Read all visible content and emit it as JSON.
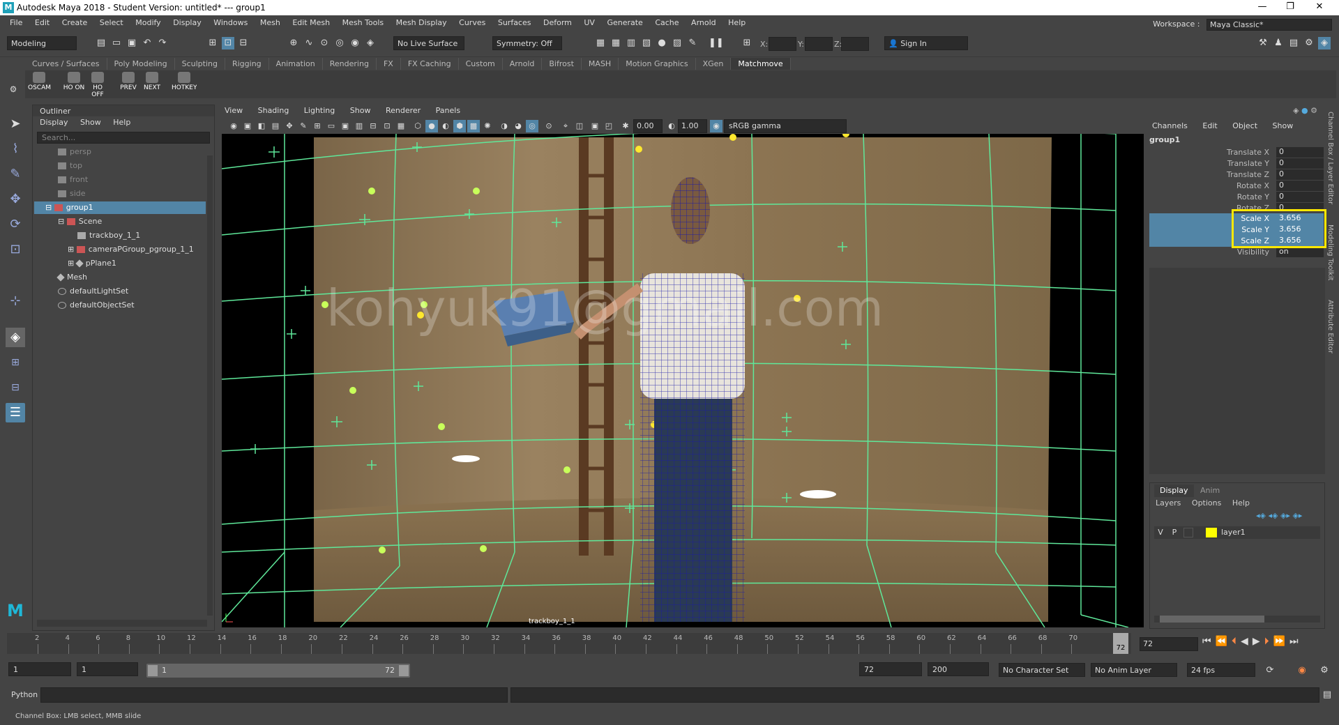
{
  "window": {
    "title": "Autodesk Maya 2018 - Student Version: untitled*   ---   group1",
    "controls": [
      "—",
      "❐",
      "✕"
    ]
  },
  "menubar": {
    "items": [
      "File",
      "Edit",
      "Create",
      "Select",
      "Modify",
      "Display",
      "Windows",
      "Mesh",
      "Edit Mesh",
      "Mesh Tools",
      "Mesh Display",
      "Curves",
      "Surfaces",
      "Deform",
      "UV",
      "Generate",
      "Cache",
      "Arnold",
      "Help"
    ],
    "workspace_label": "Workspace :",
    "workspace_value": "Maya Classic*"
  },
  "statusline": {
    "menuset": "Modeling",
    "live_surface": "No Live Surface",
    "symmetry": "Symmetry: Off",
    "x_label": "X:",
    "y_label": "Y:",
    "z_label": "Z:",
    "sign_in": "Sign In"
  },
  "shelf": {
    "tabs": [
      "Curves / Surfaces",
      "Poly Modeling",
      "Sculpting",
      "Rigging",
      "Animation",
      "Rendering",
      "FX",
      "FX Caching",
      "Custom",
      "Arnold",
      "Bifrost",
      "MASH",
      "Motion Graphics",
      "XGen",
      "Matchmove"
    ],
    "active_tab": "Matchmove",
    "buttons": [
      "OSCAM",
      "HO ON",
      "HO OFF",
      "PREV",
      "NEXT",
      "HOTKEY"
    ]
  },
  "outliner": {
    "title": "Outliner",
    "menu": [
      "Display",
      "Show",
      "Help"
    ],
    "search_placeholder": "Search...",
    "rows": [
      {
        "label": "persp",
        "dim": true
      },
      {
        "label": "top",
        "dim": true
      },
      {
        "label": "front",
        "dim": true
      },
      {
        "label": "side",
        "dim": true
      },
      {
        "label": "group1",
        "selected": true
      },
      {
        "label": "Scene"
      },
      {
        "label": "trackboy_1_1"
      },
      {
        "label": "cameraPGroup_pgroup_1_1"
      },
      {
        "label": "pPlane1"
      },
      {
        "label": "Mesh"
      },
      {
        "label": "defaultLightSet"
      },
      {
        "label": "defaultObjectSet"
      }
    ]
  },
  "viewport": {
    "menu": [
      "View",
      "Shading",
      "Lighting",
      "Show",
      "Renderer",
      "Panels"
    ],
    "exposure": "0.00",
    "gamma": "1.00",
    "color_space": "sRGB gamma",
    "camera_label": "trackboy_1_1",
    "watermark": "kohyuk91@gmail.com"
  },
  "channelbox": {
    "menu": [
      "Channels",
      "Edit",
      "Object",
      "Show"
    ],
    "object": "group1",
    "channels": [
      {
        "label": "Translate X",
        "value": "0"
      },
      {
        "label": "Translate Y",
        "value": "0"
      },
      {
        "label": "Translate Z",
        "value": "0"
      },
      {
        "label": "Rotate X",
        "value": "0"
      },
      {
        "label": "Rotate Y",
        "value": "0"
      },
      {
        "label": "Rotate Z",
        "value": "0"
      },
      {
        "label": "Scale X",
        "value": "3.656",
        "selected": true
      },
      {
        "label": "Scale Y",
        "value": "3.656",
        "selected": true
      },
      {
        "label": "Scale Z",
        "value": "3.656",
        "selected": true
      },
      {
        "label": "Visibility",
        "value": "on"
      }
    ],
    "side_tabs": [
      "Channel Box / Layer Editor",
      "Modeling Toolkit",
      "Attribute Editor"
    ]
  },
  "layers": {
    "tabs": [
      "Display",
      "Anim"
    ],
    "menu": [
      "Layers",
      "Options",
      "Help"
    ],
    "layer": {
      "v": "V",
      "p": "P",
      "name": "layer1",
      "color": "#ffff00"
    }
  },
  "timeline": {
    "ticks": [
      "2",
      "4",
      "6",
      "8",
      "10",
      "12",
      "14",
      "16",
      "18",
      "20",
      "22",
      "24",
      "26",
      "28",
      "30",
      "32",
      "34",
      "36",
      "38",
      "40",
      "42",
      "44",
      "46",
      "48",
      "50",
      "52",
      "54",
      "56",
      "58",
      "60",
      "62",
      "64",
      "66",
      "68",
      "70"
    ],
    "current_frame": "72",
    "current_field": "72"
  },
  "range": {
    "start": "1",
    "start2": "1",
    "range_start": "1",
    "range_end": "72",
    "end": "72",
    "end2": "200",
    "character_set": "No Character Set",
    "anim_layer": "No Anim Layer",
    "fps": "24 fps"
  },
  "cmd": {
    "label": "Python",
    "help": "Channel Box: LMB select, MMB slide"
  },
  "colors": {
    "selection": "#5285a6",
    "grid": "#5fe89a",
    "highlight_box": "#ffe800",
    "wireframe": "#1a1aa8"
  }
}
